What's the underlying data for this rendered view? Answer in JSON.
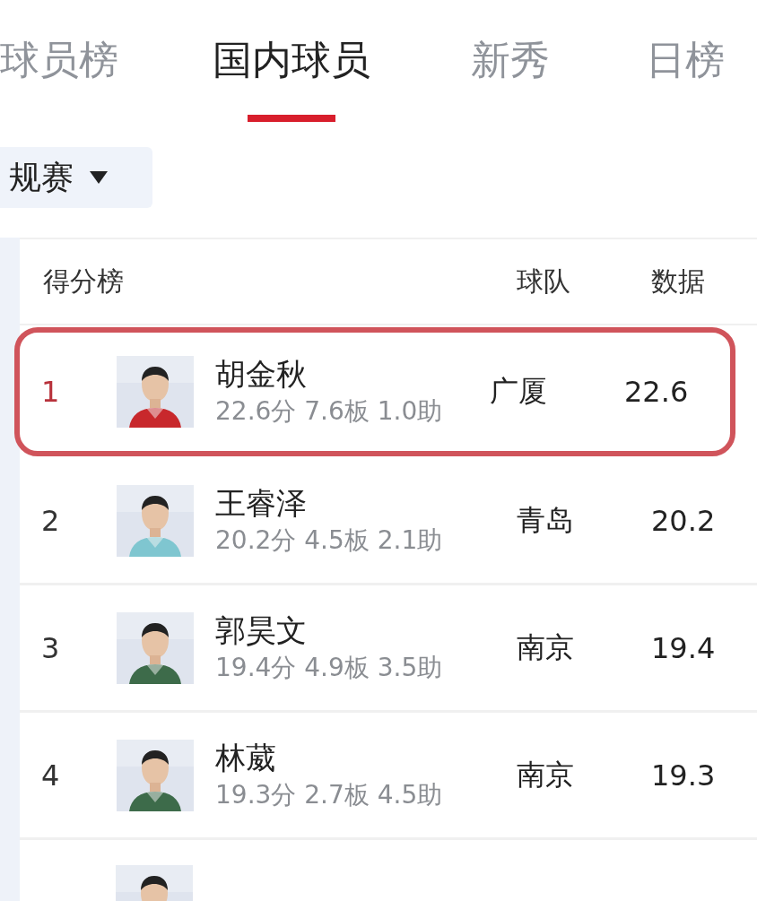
{
  "tabs": [
    {
      "label": "球员榜",
      "selected": false
    },
    {
      "label": "国内球员",
      "selected": true
    },
    {
      "label": "新秀",
      "selected": false
    },
    {
      "label": "日榜",
      "selected": false
    }
  ],
  "season_dropdown": {
    "value": "规赛"
  },
  "table": {
    "columns": [
      "得分榜",
      "球队",
      "数据"
    ],
    "rows": [
      {
        "rank": "1",
        "name": "胡金秋",
        "stats": "22.6分 7.6板 1.0助",
        "team": "广厦",
        "value": "22.6",
        "highlighted": true,
        "photo": {
          "kind": "picture"
        }
      },
      {
        "rank": "2",
        "name": "王睿泽",
        "stats": "20.2分 4.5板 2.1助",
        "team": "青岛",
        "value": "20.2",
        "highlighted": false,
        "photo": {
          "kind": "picture"
        }
      },
      {
        "rank": "3",
        "name": "郭昊文",
        "stats": "19.4分 4.9板 3.5助",
        "team": "南京",
        "value": "19.4",
        "highlighted": false,
        "photo": {
          "kind": "picture"
        }
      },
      {
        "rank": "4",
        "name": "林葳",
        "stats": "19.3分 2.7板 4.5助",
        "team": "南京",
        "value": "19.3",
        "highlighted": false,
        "photo": {
          "kind": "picture"
        }
      }
    ],
    "partial_row": {
      "photo": {
        "kind": "picture"
      }
    }
  }
}
